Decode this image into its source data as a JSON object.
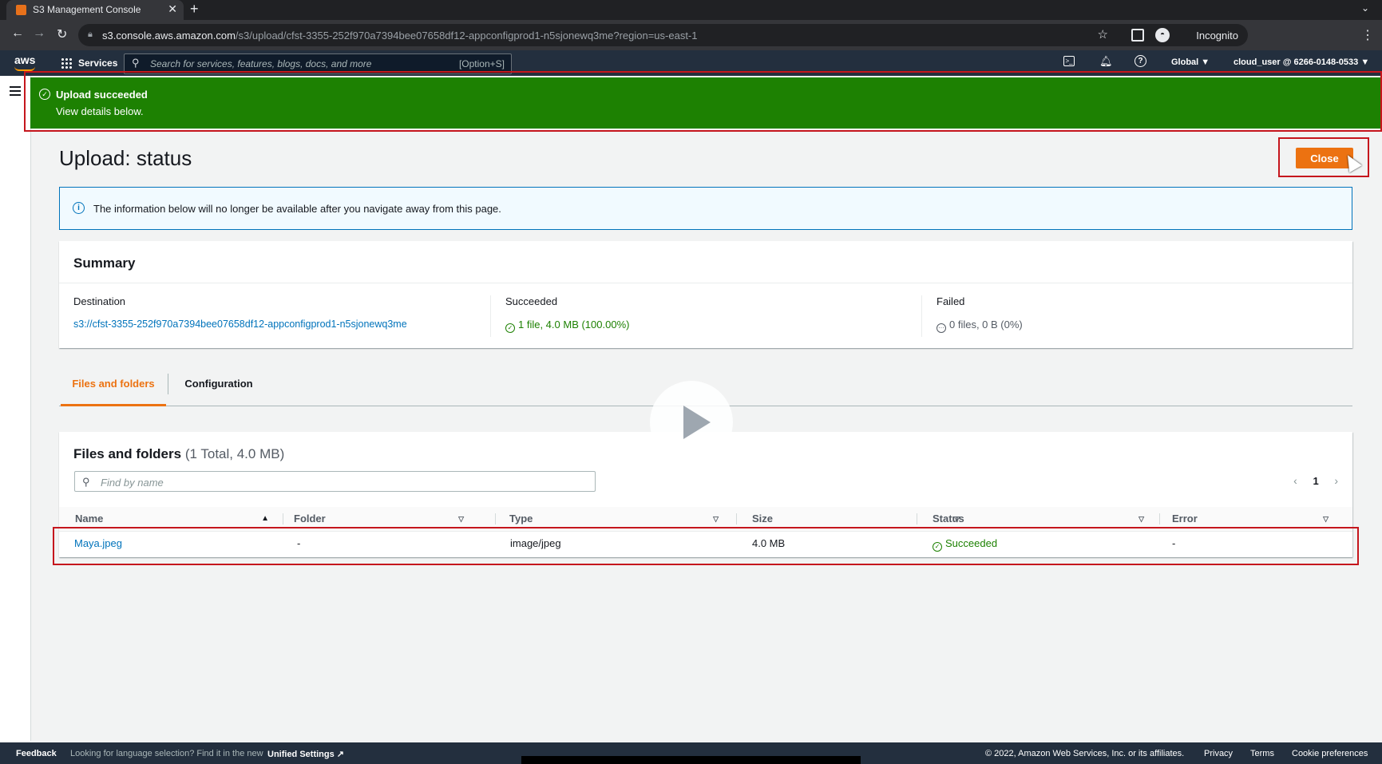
{
  "browser": {
    "tab_title": "S3 Management Console",
    "url_host": "s3.console.aws.amazon.com",
    "url_path": "/s3/upload/cfst-3355-252f970a7394bee07658df12-appconfigprod1-n5sjonewq3me?region=us-east-1",
    "incognito_label": "Incognito"
  },
  "aws_nav": {
    "logo": "aws",
    "services_label": "Services",
    "search_placeholder": "Search for services, features, blogs, docs, and more",
    "search_shortcut": "[Option+S]",
    "region": "Global ▼",
    "account": "cloud_user @ 6266-0148-0533 ▼"
  },
  "flash": {
    "title": "Upload succeeded",
    "message": "View details below."
  },
  "header": {
    "title": "Upload: status",
    "close_label": "Close"
  },
  "info": {
    "text": "The information below will no longer be available after you navigate away from this page."
  },
  "summary": {
    "title": "Summary",
    "destination_label": "Destination",
    "destination_value": "s3://cfst-3355-252f970a7394bee07658df12-appconfigprod1-n5sjonewq3me",
    "succeeded_label": "Succeeded",
    "succeeded_value": "1 file, 4.0 MB (100.00%)",
    "failed_label": "Failed",
    "failed_value": "0 files, 0 B (0%)"
  },
  "tabs": [
    {
      "label": "Files and folders",
      "active": true
    },
    {
      "label": "Configuration",
      "active": false
    }
  ],
  "files": {
    "title": "Files and folders",
    "count": "(1 Total, 4.0 MB)",
    "find_placeholder": "Find by name",
    "page": "1",
    "columns": [
      "Name",
      "Folder",
      "Type",
      "Size",
      "Status",
      "Error"
    ],
    "rows": [
      {
        "name": "Maya.jpeg",
        "folder": "-",
        "type": "image/jpeg",
        "size": "4.0 MB",
        "status": "Succeeded",
        "error": "-"
      }
    ]
  },
  "footer": {
    "feedback": "Feedback",
    "lang_text": "Looking for language selection? Find it in the new",
    "unified_settings": "Unified Settings",
    "copyright": "© 2022, Amazon Web Services, Inc. or its affiliates.",
    "privacy": "Privacy",
    "terms": "Terms",
    "cookies": "Cookie preferences"
  },
  "colors": {
    "success": "#1d8102",
    "primary_button": "#ec7211",
    "link": "#0073bb",
    "nav_bg": "#232f3e",
    "highlight_frame": "#c5161d"
  }
}
